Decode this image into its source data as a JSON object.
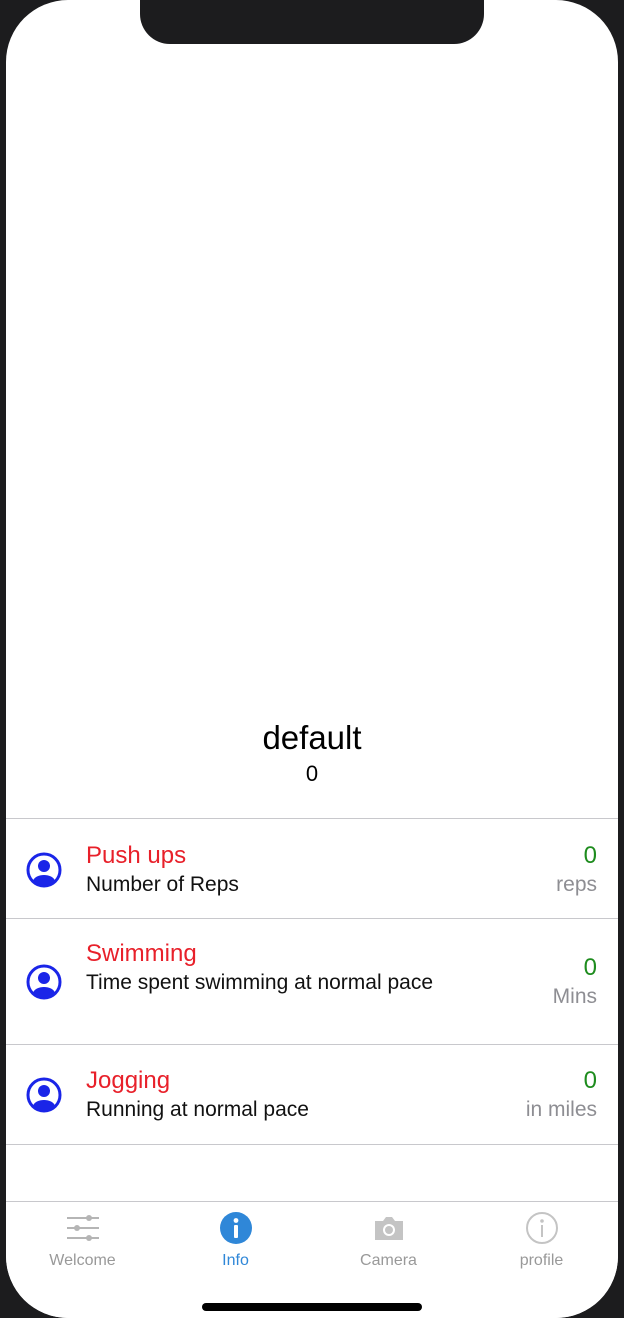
{
  "summary": {
    "title": "default",
    "value": "0"
  },
  "exercises": [
    {
      "icon": "user-avatar-icon",
      "title": "Push ups",
      "description": "Number of Reps",
      "value": "0",
      "unit": "reps"
    },
    {
      "icon": "user-avatar-icon",
      "title": "Swimming",
      "description": "Time spent swimming at normal pace",
      "value": "0",
      "unit": "Mins"
    },
    {
      "icon": "user-avatar-icon",
      "title": "Jogging",
      "description": "Running at normal pace",
      "value": "0",
      "unit": "in miles"
    }
  ],
  "tabbar": {
    "tabs": [
      {
        "label": "Welcome",
        "icon": "sliders-icon",
        "active": false
      },
      {
        "label": "Info",
        "icon": "info-filled-icon",
        "active": true
      },
      {
        "label": "Camera",
        "icon": "camera-icon",
        "active": false
      },
      {
        "label": "profile",
        "icon": "info-outline-icon",
        "active": false
      }
    ]
  },
  "colors": {
    "title_red": "#e8202a",
    "value_green": "#1e8c1e",
    "avatar_blue": "#1a25e8",
    "tab_active_blue": "#2f87d8",
    "tab_inactive_gray": "#999999"
  }
}
